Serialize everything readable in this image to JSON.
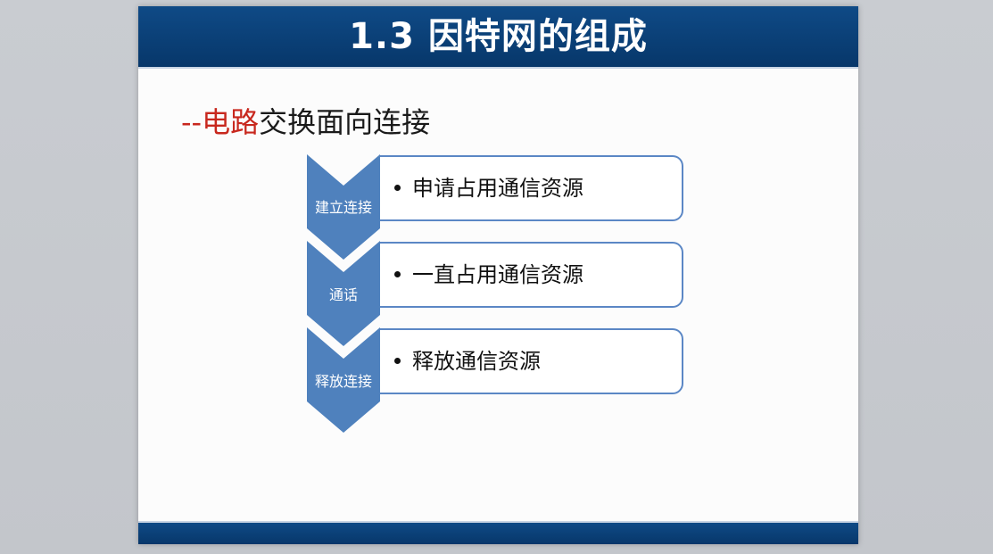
{
  "slide": {
    "title": "1.3  因特网的组成",
    "subtitle_prefix": "--",
    "subtitle_red": "电路",
    "subtitle_rest": "交换面向连接",
    "colors": {
      "title_bar": "#0b4379",
      "chevron": "#4f81bd",
      "box_border": "#5b87c5",
      "accent_red": "#c8281e"
    }
  },
  "process_steps": [
    {
      "label": "建立连接",
      "detail": "申请占用通信资源"
    },
    {
      "label": "通话",
      "detail": "一直占用通信资源"
    },
    {
      "label": "释放连接",
      "detail": "释放通信资源"
    }
  ]
}
